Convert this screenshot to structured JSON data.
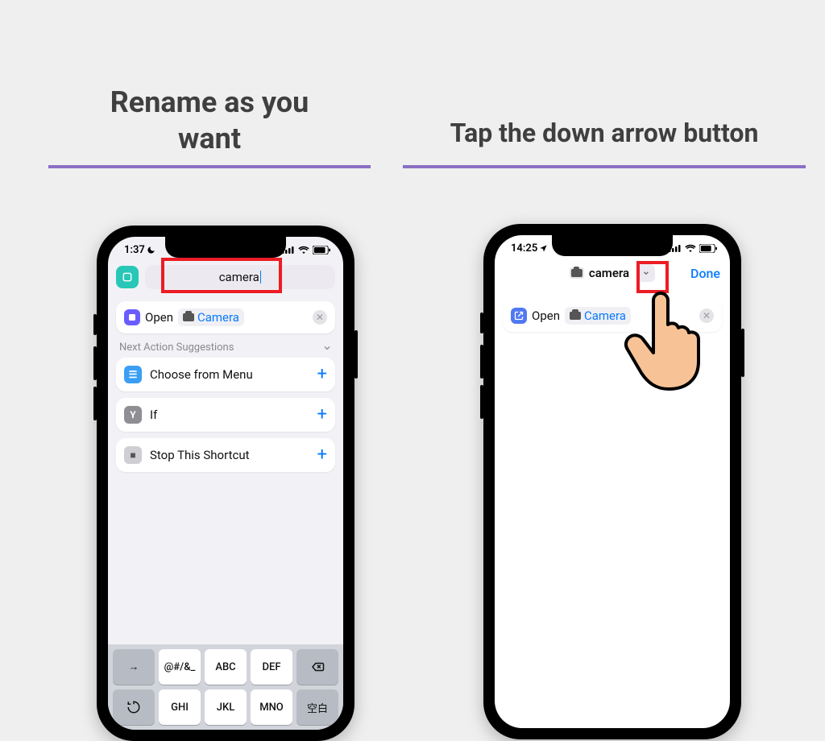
{
  "captions": {
    "left_line1": "Rename as you",
    "left_line2": "want",
    "right": "Tap the down arrow button"
  },
  "colors": {
    "underline": "#8b6fc4",
    "highlight": "#ec1c24",
    "ios_blue": "#0a7aff",
    "teal": "#28c7b7"
  },
  "left_phone": {
    "time": "1:37",
    "status_icon": "moon",
    "shortcut_name": "camera",
    "action": {
      "verb": "Open",
      "app": "Camera"
    },
    "suggestions_header": "Next Action Suggestions",
    "suggestions": [
      {
        "label": "Choose from Menu",
        "icon": "menu"
      },
      {
        "label": "If",
        "icon": "if"
      },
      {
        "label": "Stop This Shortcut",
        "icon": "stop"
      }
    ],
    "keyboard": {
      "row1": [
        "→",
        "@#/&_",
        "ABC",
        "DEF",
        "⌫"
      ],
      "row2": [
        "↺",
        "GHI",
        "JKL",
        "MNO",
        "空白"
      ]
    }
  },
  "right_phone": {
    "time": "14:25",
    "status_icon": "location",
    "shortcut_name": "camera",
    "done_label": "Done",
    "action": {
      "verb": "Open",
      "app": "Camera"
    }
  }
}
